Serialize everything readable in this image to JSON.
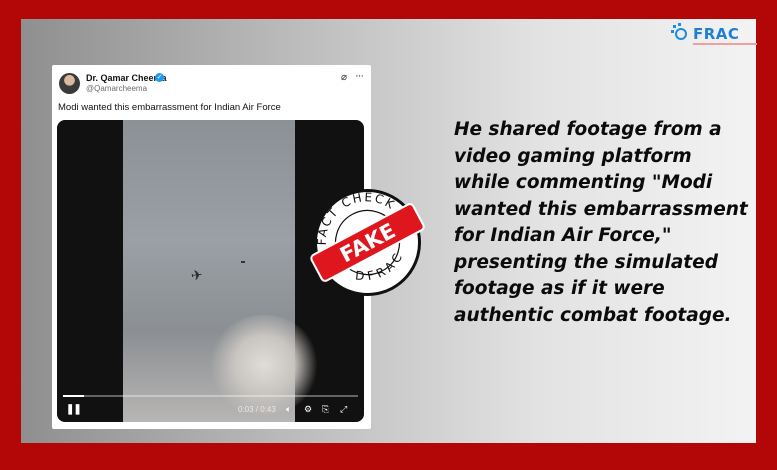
{
  "tweet": {
    "author_name": "Dr. Qamar Cheema",
    "handle": "@Qamarcheema",
    "text": "Modi wanted this embarrassment for Indian Air Force"
  },
  "video": {
    "time": "0:03 / 0:43",
    "progress": 0.07
  },
  "stamp": {
    "top_text": "FACT CHECK",
    "label": "FAKE",
    "bottom_text": "DFRAC"
  },
  "logo": {
    "text": "FRAC"
  },
  "caption": "He shared footage from a video gaming platform while commenting \"Modi wanted this embarrassment for Indian Air Force,\" presenting the simulated footage as if it were authentic combat footage.",
  "colors": {
    "border": "#b30606",
    "stamp_red": "#e0161e",
    "logo_blue": "#1f7fd6"
  }
}
